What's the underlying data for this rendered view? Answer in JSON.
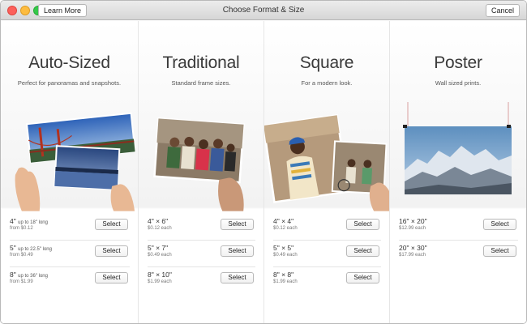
{
  "window": {
    "title": "Choose Format & Size",
    "learn_more": "Learn More",
    "cancel": "Cancel"
  },
  "columns": [
    {
      "title": "Auto-Sized",
      "subtitle": "Perfect for panoramas and snapshots.",
      "options": [
        {
          "size": "4\"",
          "size_note": "up to 18\" long",
          "price": "from $0.12",
          "button": "Select"
        },
        {
          "size": "5\"",
          "size_note": "up to 22.5\" long",
          "price": "from $0.49",
          "button": "Select"
        },
        {
          "size": "8\"",
          "size_note": "up to 36\" long",
          "price": "from $1.99",
          "button": "Select"
        }
      ]
    },
    {
      "title": "Traditional",
      "subtitle": "Standard frame sizes.",
      "options": [
        {
          "size": "4\" × 6\"",
          "size_note": "",
          "price": "$0.12 each",
          "button": "Select"
        },
        {
          "size": "5\" × 7\"",
          "size_note": "",
          "price": "$0.49 each",
          "button": "Select"
        },
        {
          "size": "8\" × 10\"",
          "size_note": "",
          "price": "$1.99 each",
          "button": "Select"
        }
      ]
    },
    {
      "title": "Square",
      "subtitle": "For a modern look.",
      "options": [
        {
          "size": "4\" × 4\"",
          "size_note": "",
          "price": "$0.12 each",
          "button": "Select"
        },
        {
          "size": "5\" × 5\"",
          "size_note": "",
          "price": "$0.49 each",
          "button": "Select"
        },
        {
          "size": "8\" × 8\"",
          "size_note": "",
          "price": "$1.99 each",
          "button": "Select"
        }
      ]
    },
    {
      "title": "Poster",
      "subtitle": "Wall sized prints.",
      "options": [
        {
          "size": "16\" × 20\"",
          "size_note": "",
          "price": "$12.99 each",
          "button": "Select"
        },
        {
          "size": "20\" × 30\"",
          "size_note": "",
          "price": "$17.99 each",
          "button": "Select"
        }
      ]
    }
  ]
}
